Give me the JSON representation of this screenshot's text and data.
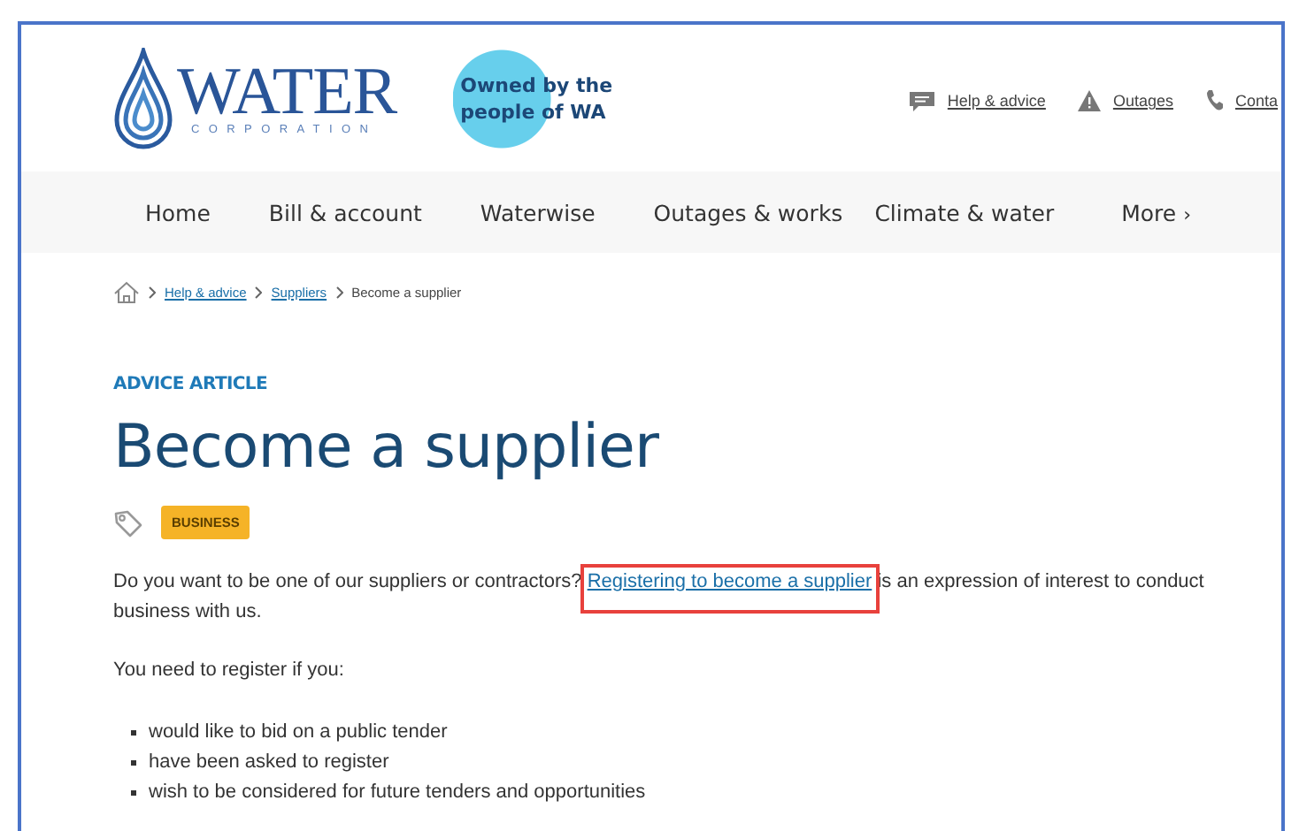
{
  "header": {
    "logo": {
      "title": "WATER",
      "subtitle": "CORPORATION"
    },
    "slogan": "Owned by the people of WA",
    "utility_links": [
      {
        "kind": "chat",
        "label": "Help & advice"
      },
      {
        "kind": "warning",
        "label": "Outages"
      },
      {
        "kind": "phone",
        "label": "Conta"
      }
    ]
  },
  "nav": {
    "items": [
      {
        "label": "Home"
      },
      {
        "label": "Bill & account"
      },
      {
        "label": "Waterwise"
      },
      {
        "label": "Outages & works"
      },
      {
        "label": "Climate & water"
      },
      {
        "label": "More",
        "arrow": "›"
      }
    ]
  },
  "breadcrumb": [
    {
      "label": "Help & advice",
      "link": true
    },
    {
      "label": "Suppliers",
      "link": true
    },
    {
      "label": "Become a supplier",
      "link": false
    }
  ],
  "article": {
    "eyebrow": "ADVICE ARTICLE",
    "title": "Become a supplier",
    "tag": "BUSINESS",
    "intro": {
      "before": "Do you want to be one of our suppliers or contractors?",
      "link": "Registering to become a supplier",
      "link_highlighted": true,
      "after": "is an expression of interest to conduct business with us."
    },
    "lead": "You need to register if you:",
    "bullets": [
      "would like to bid on a public tender",
      "have been asked to register",
      "wish to be considered for future tenders and opportunities"
    ]
  }
}
